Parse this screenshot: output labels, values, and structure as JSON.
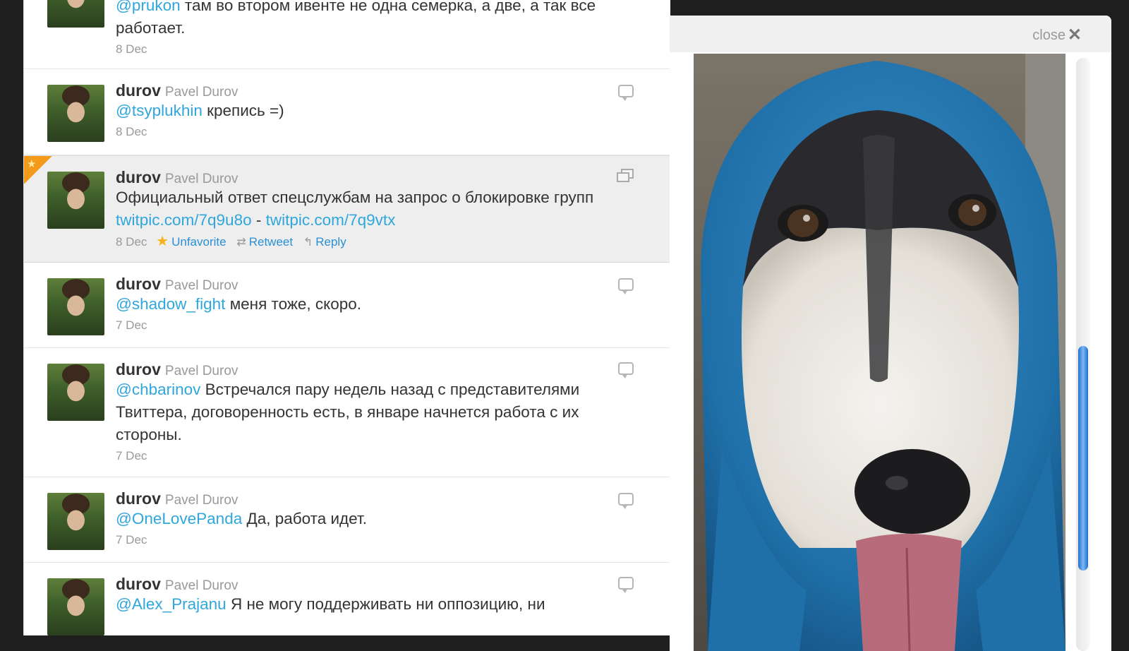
{
  "timeline": {
    "tweets": [
      {
        "text_parts": [
          {
            "type": "mention",
            "text": "@prukon"
          },
          {
            "type": "text",
            "text": " там во втором ивенте не одна семерка, а две, а так все работает."
          }
        ],
        "date": "8 Dec"
      },
      {
        "handle": "durov",
        "fullname": "Pavel Durov",
        "text_parts": [
          {
            "type": "mention",
            "text": "@tsyplukhin"
          },
          {
            "type": "text",
            "text": " крепись =)"
          }
        ],
        "date": "8 Dec"
      },
      {
        "handle": "durov",
        "fullname": "Pavel Durov",
        "text_parts": [
          {
            "type": "text",
            "text": "Официальный ответ спецслужбам на запрос о блокировке групп "
          },
          {
            "type": "link",
            "text": "twitpic.com/7q9u8o"
          },
          {
            "type": "text",
            "text": " - "
          },
          {
            "type": "link",
            "text": "twitpic.com/7q9vtx"
          }
        ],
        "date": "8 Dec",
        "actions": {
          "unfavorite": "Unfavorite",
          "retweet": "Retweet",
          "reply": "Reply"
        }
      },
      {
        "handle": "durov",
        "fullname": "Pavel Durov",
        "text_parts": [
          {
            "type": "mention",
            "text": "@shadow_fight"
          },
          {
            "type": "text",
            "text": " меня тоже, скоро."
          }
        ],
        "date": "7 Dec"
      },
      {
        "handle": "durov",
        "fullname": "Pavel Durov",
        "text_parts": [
          {
            "type": "mention",
            "text": "@chbarinov"
          },
          {
            "type": "text",
            "text": " Встречался пару недель назад с представителями Твиттера, договоренность есть, в январе начнется работа с их стороны."
          }
        ],
        "date": "7 Dec"
      },
      {
        "handle": "durov",
        "fullname": "Pavel Durov",
        "text_parts": [
          {
            "type": "mention",
            "text": "@OneLovePanda"
          },
          {
            "type": "text",
            "text": " Да, работа идет."
          }
        ],
        "date": "7 Dec"
      },
      {
        "handle": "durov",
        "fullname": "Pavel Durov",
        "text_parts": [
          {
            "type": "mention",
            "text": "@Alex_Prajanu"
          },
          {
            "type": "text",
            "text": " Я не могу поддерживать ни оппозицию, ни"
          }
        ]
      }
    ]
  },
  "modal": {
    "close_label": "close",
    "close_glyph": "✕"
  },
  "colors": {
    "link": "#2fa6dc",
    "action": "#2b8fd6",
    "favorite": "#f39a1a"
  }
}
